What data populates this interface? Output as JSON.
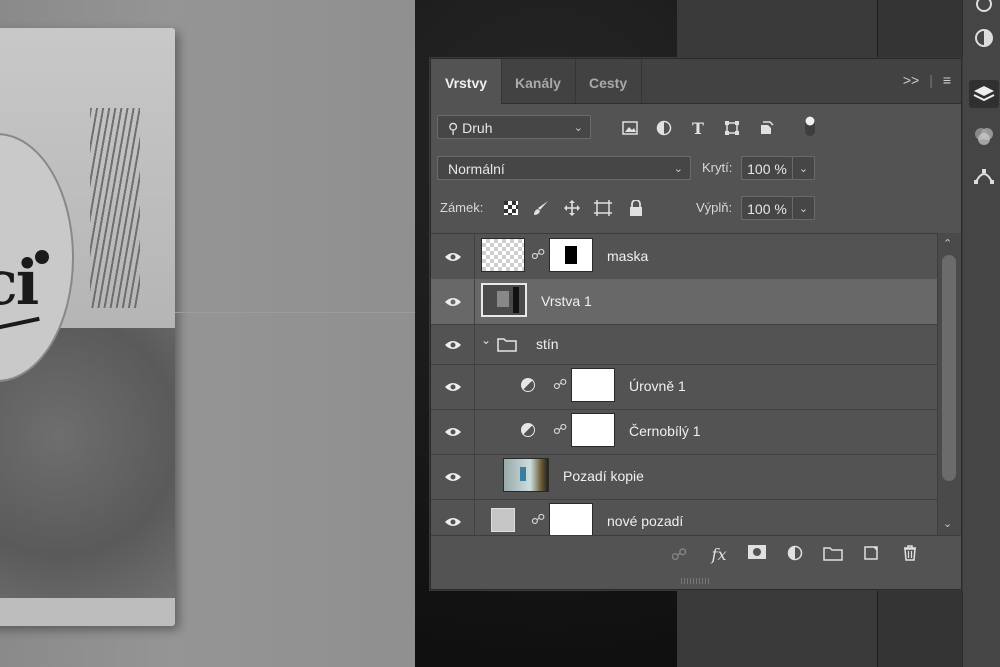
{
  "panel": {
    "tabs": [
      "Vrstvy",
      "Kanály",
      "Cesty"
    ],
    "active_tab": "Vrstvy",
    "filter": {
      "label": "Druh"
    },
    "blend_mode": "Normální",
    "opacity": {
      "label": "Krytí:",
      "value": "100 %"
    },
    "lock": {
      "label": "Zámek:"
    },
    "fill": {
      "label": "Výplň:",
      "value": "100 %"
    },
    "layers": [
      {
        "name": "maska",
        "type": "layer-with-mask",
        "visible": true
      },
      {
        "name": "Vrstva 1",
        "type": "smart-object",
        "visible": true,
        "selected": true
      },
      {
        "name": "stín",
        "type": "group",
        "visible": true,
        "expanded": true
      },
      {
        "name": "Úrovně 1",
        "type": "adjustment",
        "visible": true
      },
      {
        "name": "Černobílý 1",
        "type": "adjustment",
        "visible": true
      },
      {
        "name": "Pozadí kopie",
        "type": "pixel",
        "visible": true
      },
      {
        "name": "nové pozadí",
        "type": "fill-with-mask",
        "visible": true
      }
    ]
  },
  "canvas": {
    "book_title_fragment": "ci"
  },
  "icons": [
    "search-icon",
    "image-filter-icon",
    "adjustment-filter-icon",
    "type-filter-icon",
    "shape-filter-icon",
    "smartobject-filter-icon",
    "filter-toggle-icon",
    "lock-transparent-icon",
    "lock-image-icon",
    "lock-position-icon",
    "lock-artboard-icon",
    "lock-all-icon",
    "eye-icon",
    "link-icon",
    "fx-icon",
    "mask-icon",
    "new-adjustment-icon",
    "new-group-icon",
    "new-layer-icon",
    "trash-icon"
  ],
  "colors": {
    "panel_bg": "#535353",
    "selected_row": "#686868",
    "tab_bar": "#424242"
  }
}
